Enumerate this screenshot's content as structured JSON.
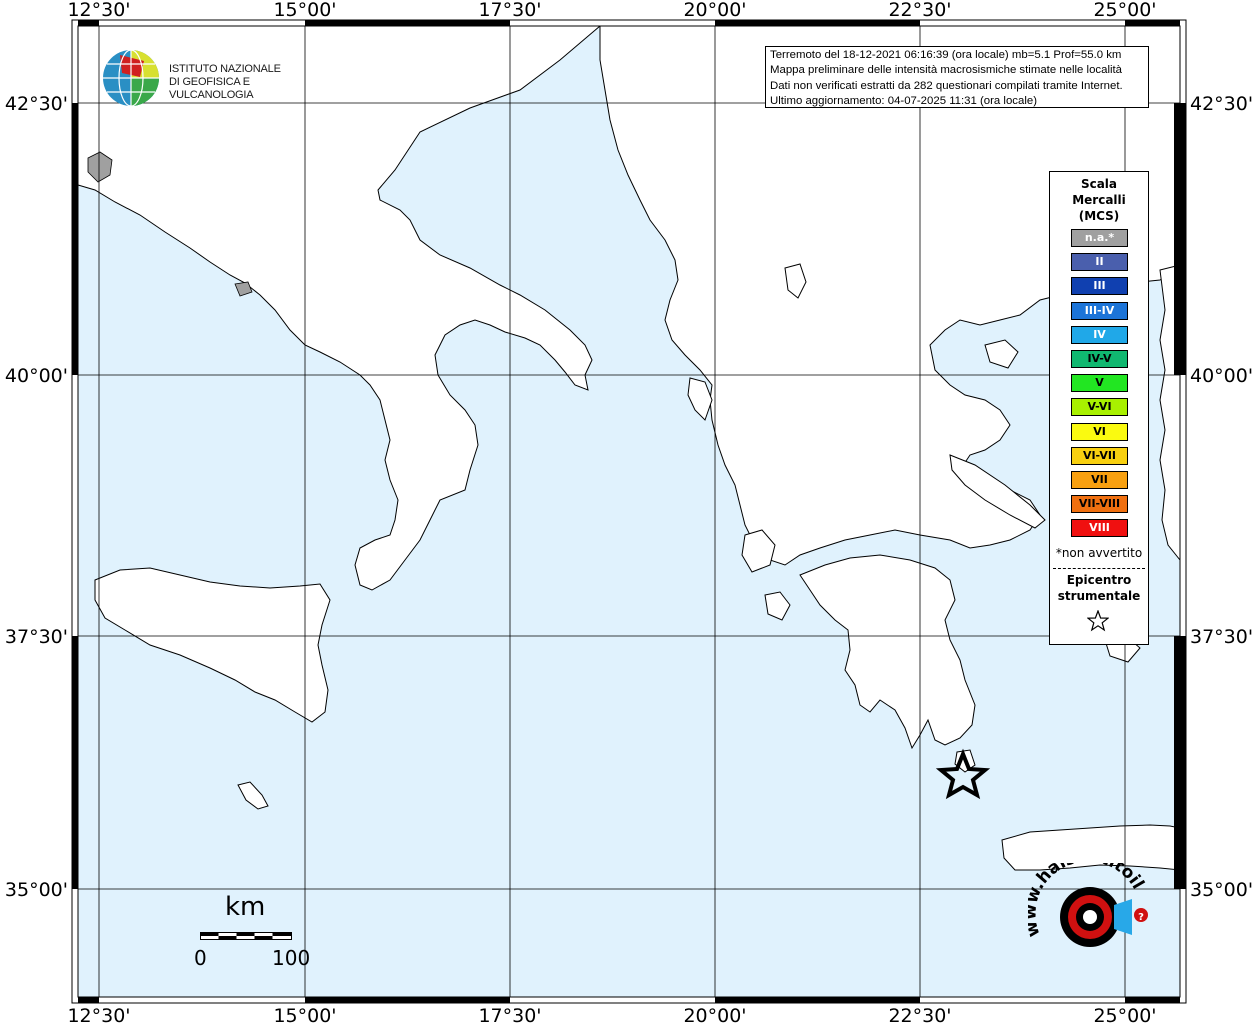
{
  "map": {
    "lon_ticks": [
      "12°30'",
      "15°00'",
      "17°30'",
      "20°00'",
      "22°30'",
      "25°00'"
    ],
    "lat_ticks": [
      "42°30'",
      "40°00'",
      "37°30'",
      "35°00'"
    ]
  },
  "info": {
    "line1": "Terremoto del 18-12-2021 06:16:39 (ora locale) mb=5.1 Prof=55.0 km",
    "line2": "Mappa preliminare delle intensità macrosismiche stimate nelle località",
    "line3": "Dati non verificati estratti da 282 questionari compilati tramite Internet.",
    "line4": "Ultimo aggiornamento: 04-07-2025 11:31 (ora locale)"
  },
  "institute": {
    "line1": "ISTITUTO NAZIONALE",
    "line2": "DI GEOFISICA E VULCANOLOGIA"
  },
  "legend": {
    "title_line1": "Scala",
    "title_line2": "Mercalli",
    "title_line3": "(MCS)",
    "items": [
      {
        "label": "n.a.*",
        "color": "#a0a0a0",
        "text_color": "#ffffff"
      },
      {
        "label": "II",
        "color": "#4a5fad",
        "text_color": "#ffffff"
      },
      {
        "label": "III",
        "color": "#1040b0",
        "text_color": "#ffffff"
      },
      {
        "label": "III-IV",
        "color": "#1c74d8",
        "text_color": "#ffffff"
      },
      {
        "label": "IV",
        "color": "#20a8e8",
        "text_color": "#ffffff"
      },
      {
        "label": "IV-V",
        "color": "#10b870",
        "text_color": "#000000"
      },
      {
        "label": "V",
        "color": "#22e622",
        "text_color": "#000000"
      },
      {
        "label": "V-VI",
        "color": "#a8f000",
        "text_color": "#000000"
      },
      {
        "label": "VI",
        "color": "#fafa10",
        "text_color": "#000000"
      },
      {
        "label": "VI-VII",
        "color": "#f8d010",
        "text_color": "#000000"
      },
      {
        "label": "VII",
        "color": "#f8a010",
        "text_color": "#000000"
      },
      {
        "label": "VII-VIII",
        "color": "#f07010",
        "text_color": "#000000"
      },
      {
        "label": "VIII",
        "color": "#f01010",
        "text_color": "#ffffff"
      }
    ],
    "note": "*non avvertito",
    "epicenter_line1": "Epicentro",
    "epicenter_line2": "strumentale"
  },
  "scale_bar": {
    "unit": "km",
    "start": "0",
    "end": "100"
  },
  "site_logo": {
    "text": "www.haisentitoilterremoto.it",
    "accent": "#d01010"
  },
  "colors": {
    "sea": "#e0f2fd",
    "land": "#ffffff"
  }
}
